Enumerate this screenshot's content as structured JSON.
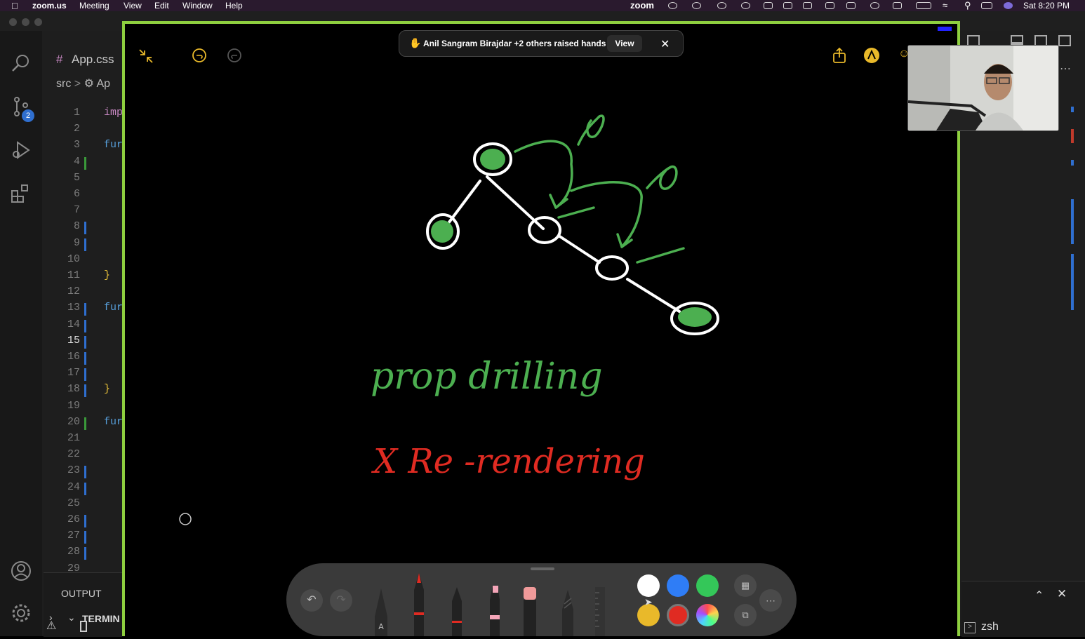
{
  "menubar": {
    "app": "zoom.us",
    "items": [
      "Meeting",
      "View",
      "Edit",
      "Window",
      "Help"
    ],
    "brand": "zoom",
    "clock": "Sat 8:20 PM"
  },
  "vscode": {
    "tab": {
      "label": "App.css",
      "icon": "#"
    },
    "breadcrumb": {
      "folder": "src",
      "file": "Ap"
    },
    "scm_badge": "2",
    "lines": [
      "1",
      "2",
      "3",
      "4",
      "5",
      "6",
      "7",
      "8",
      "9",
      "10",
      "11",
      "12",
      "13",
      "14",
      "15",
      "16",
      "17",
      "18",
      "19",
      "20",
      "21",
      "22",
      "23",
      "24",
      "25",
      "26",
      "27",
      "28",
      "29"
    ],
    "active_line": "15",
    "code": {
      "l1": "imp",
      "l3": "fur",
      "l11": "}",
      "l13": "fur",
      "l18": "}",
      "l20": "fur"
    },
    "panel": {
      "output": "OUTPUT",
      "terminal": "TERMIN"
    },
    "terminal_shell": "zsh"
  },
  "zoom": {
    "banner_text": "Anil Sangram Birajdar +2 others raised hands",
    "banner_view": "View",
    "annotation_text": {
      "line1": "prop drilling",
      "line2": "X Re -rendering"
    },
    "colors": {
      "border_green": "#8ecf3f",
      "white": "#ffffff",
      "blue": "#2f7df6",
      "green": "#34c759",
      "yellow": "#e9b92a",
      "red": "#e02b22"
    }
  }
}
